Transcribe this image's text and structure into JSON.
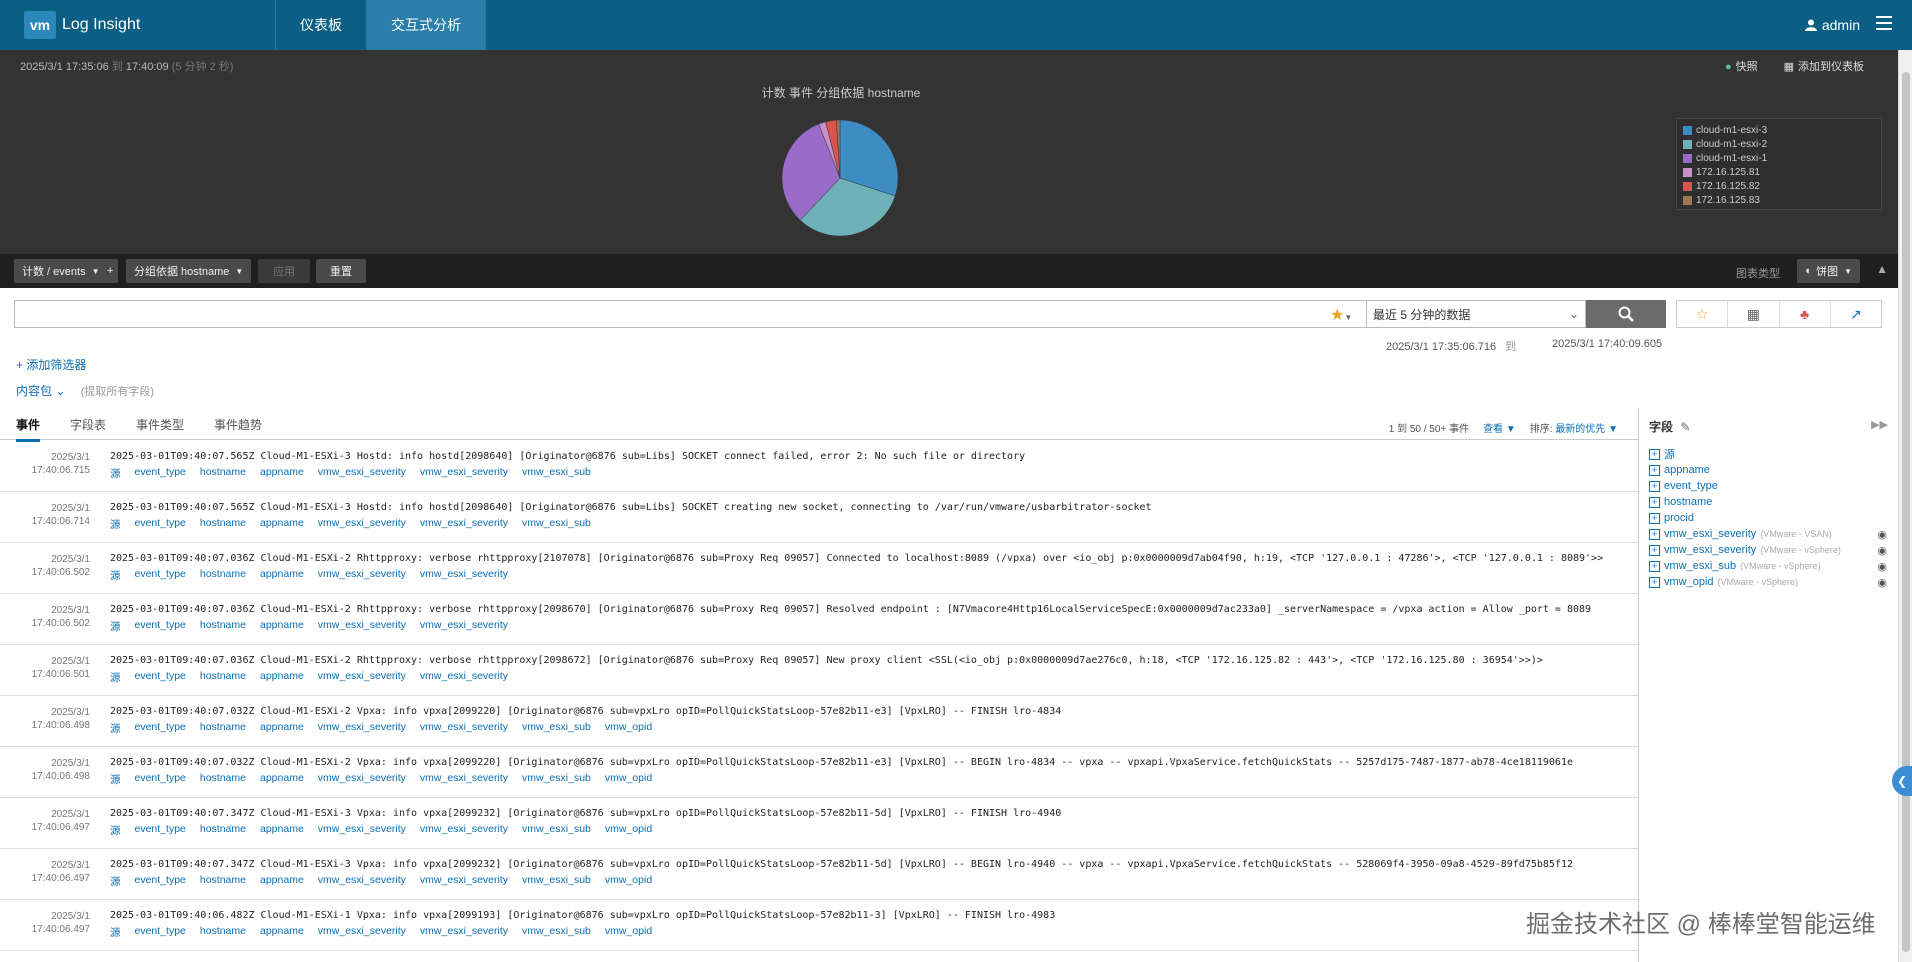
{
  "topbar": {
    "logo_badge": "vm",
    "app_name": "Log Insight",
    "tabs": [
      {
        "label": "仪表板",
        "active": false
      },
      {
        "label": "交互式分析",
        "active": true
      }
    ],
    "user": "admin"
  },
  "chart_panel": {
    "time_from": "2025/3/1  17:35:06",
    "time_to_sep": "到",
    "time_to": "17:40:09",
    "duration": "(5 分钟 2 秒)",
    "snapshot_label": "快照",
    "add_dashboard_label": "添加到仪表板"
  },
  "chart_data": {
    "type": "pie",
    "title": "计数 事件 分组依据 hostname",
    "categories": [
      "cloud-m1-esxi-3",
      "cloud-m1-esxi-2",
      "cloud-m1-esxi-1",
      "172.16.125.81",
      "172.16.125.82",
      "172.16.125.83"
    ],
    "values": [
      30,
      32,
      32,
      2,
      3,
      1
    ],
    "colors": [
      "#3d8cc4",
      "#6fb1b8",
      "#9a6bc8",
      "#c98fc9",
      "#d9534f",
      "#a07a4f"
    ],
    "legend": "right"
  },
  "toolbar": {
    "count_label": "计数 / events",
    "add_label": "+",
    "group_label": "分组依据 hostname",
    "apply_label": "应用",
    "reset_label": "重置",
    "chart_type_label": "图表类型",
    "chart_type_value": "饼图"
  },
  "search": {
    "query": "",
    "placeholder": "",
    "time_option": "最近 5 分钟的数据",
    "date_from": "2025/3/1 17:35:06.716",
    "date_sep": "到",
    "date_to": "2025/3/1 17:40:09.605"
  },
  "filters": {
    "add_filter": "+ 添加筛选器",
    "content_pack": "内容包",
    "extract_all": "(提取所有字段)"
  },
  "subtabs": [
    "事件",
    "字段表",
    "事件类型",
    "事件趋势"
  ],
  "pager": {
    "count_text": "1 到 50 / 50+ 事件",
    "view_label": "查看",
    "sort_label": "排序:",
    "sort_value": "最新的优先"
  },
  "events": [
    {
      "date": "2025/3/1",
      "time": "17:40:06.715",
      "msg": "2025-03-01T09:40:07.565Z Cloud-M1-ESXi-3 Hostd: info hostd[2098640] [Originator@6876 sub=Libs] SOCKET connect failed, error 2: No such file or directory",
      "tags": [
        "源",
        "event_type",
        "hostname",
        "appname",
        "vmw_esxi_severity",
        "vmw_esxi_severity",
        "vmw_esxi_sub"
      ]
    },
    {
      "date": "2025/3/1",
      "time": "17:40:06.714",
      "msg": "2025-03-01T09:40:07.565Z Cloud-M1-ESXi-3 Hostd: info hostd[2098640] [Originator@6876 sub=Libs] SOCKET creating new socket, connecting to /var/run/vmware/usbarbitrator-socket",
      "tags": [
        "源",
        "event_type",
        "hostname",
        "appname",
        "vmw_esxi_severity",
        "vmw_esxi_severity",
        "vmw_esxi_sub"
      ]
    },
    {
      "date": "2025/3/1",
      "time": "17:40:06.502",
      "msg": "2025-03-01T09:40:07.036Z Cloud-M1-ESXi-2 Rhttpproxy: verbose rhttpproxy[2107078] [Originator@6876 sub=Proxy Req 09057] Connected to localhost:8089 (/vpxa) over <io_obj p:0x0000009d7ab04f90, h:19, <TCP '127.0.0.1 : 47286'>, <TCP '127.0.0.1 : 8089'>>",
      "tags": [
        "源",
        "event_type",
        "hostname",
        "appname",
        "vmw_esxi_severity",
        "vmw_esxi_severity"
      ]
    },
    {
      "date": "2025/3/1",
      "time": "17:40:06.502",
      "msg": "2025-03-01T09:40:07.036Z Cloud-M1-ESXi-2 Rhttpproxy: verbose rhttpproxy[2098670] [Originator@6876 sub=Proxy Req 09057] Resolved endpoint : [N7Vmacore4Http16LocalServiceSpecE:0x0000009d7ac233a0] _serverNamespace = /vpxa action = Allow _port = 8089",
      "tags": [
        "源",
        "event_type",
        "hostname",
        "appname",
        "vmw_esxi_severity",
        "vmw_esxi_severity"
      ]
    },
    {
      "date": "2025/3/1",
      "time": "17:40:06.501",
      "msg": "2025-03-01T09:40:07.036Z Cloud-M1-ESXi-2 Rhttpproxy: verbose rhttpproxy[2098672] [Originator@6876 sub=Proxy Req 09057] New proxy client <SSL(<io_obj p:0x0000009d7ae276c0, h:18, <TCP '172.16.125.82 : 443'>, <TCP '172.16.125.80 : 36954'>>)>",
      "tags": [
        "源",
        "event_type",
        "hostname",
        "appname",
        "vmw_esxi_severity",
        "vmw_esxi_severity"
      ]
    },
    {
      "date": "2025/3/1",
      "time": "17:40:06.498",
      "msg": "2025-03-01T09:40:07.032Z Cloud-M1-ESXi-2 Vpxa: info vpxa[2099220] [Originator@6876 sub=vpxLro opID=PollQuickStatsLoop-57e82b11-e3] [VpxLRO] -- FINISH lro-4834",
      "tags": [
        "源",
        "event_type",
        "hostname",
        "appname",
        "vmw_esxi_severity",
        "vmw_esxi_severity",
        "vmw_esxi_sub",
        "vmw_opid"
      ]
    },
    {
      "date": "2025/3/1",
      "time": "17:40:06.498",
      "msg": "2025-03-01T09:40:07.032Z Cloud-M1-ESXi-2 Vpxa: info vpxa[2099220] [Originator@6876 sub=vpxLro opID=PollQuickStatsLoop-57e82b11-e3] [VpxLRO] -- BEGIN lro-4834 -- vpxa -- vpxapi.VpxaService.fetchQuickStats -- 5257d175-7487-1877-ab78-4ce18119061e",
      "tags": [
        "源",
        "event_type",
        "hostname",
        "appname",
        "vmw_esxi_severity",
        "vmw_esxi_severity",
        "vmw_esxi_sub",
        "vmw_opid"
      ]
    },
    {
      "date": "2025/3/1",
      "time": "17:40:06.497",
      "msg": "2025-03-01T09:40:07.347Z Cloud-M1-ESXi-3 Vpxa: info vpxa[2099232] [Originator@6876 sub=vpxLro opID=PollQuickStatsLoop-57e82b11-5d] [VpxLRO] -- FINISH lro-4940",
      "tags": [
        "源",
        "event_type",
        "hostname",
        "appname",
        "vmw_esxi_severity",
        "vmw_esxi_severity",
        "vmw_esxi_sub",
        "vmw_opid"
      ]
    },
    {
      "date": "2025/3/1",
      "time": "17:40:06.497",
      "msg": "2025-03-01T09:40:07.347Z Cloud-M1-ESXi-3 Vpxa: info vpxa[2099232] [Originator@6876 sub=vpxLro opID=PollQuickStatsLoop-57e82b11-5d] [VpxLRO] -- BEGIN lro-4940 -- vpxa -- vpxapi.VpxaService.fetchQuickStats -- 528069f4-3950-09a8-4529-89fd75b85f12",
      "tags": [
        "源",
        "event_type",
        "hostname",
        "appname",
        "vmw_esxi_severity",
        "vmw_esxi_severity",
        "vmw_esxi_sub",
        "vmw_opid"
      ]
    },
    {
      "date": "2025/3/1",
      "time": "17:40:06.497",
      "msg": "2025-03-01T09:40:06.482Z Cloud-M1-ESXi-1 Vpxa: info vpxa[2099193] [Originator@6876 sub=vpxLro opID=PollQuickStatsLoop-57e82b11-3] [VpxLRO] -- FINISH lro-4983",
      "tags": [
        "源",
        "event_type",
        "hostname",
        "appname",
        "vmw_esxi_severity",
        "vmw_esxi_severity",
        "vmw_esxi_sub",
        "vmw_opid"
      ]
    }
  ],
  "fields_panel": {
    "title": "字段",
    "fields": [
      {
        "name": "源",
        "source": "",
        "eye": false
      },
      {
        "name": "appname",
        "source": "",
        "eye": false
      },
      {
        "name": "event_type",
        "source": "",
        "eye": false
      },
      {
        "name": "hostname",
        "source": "",
        "eye": false
      },
      {
        "name": "procid",
        "source": "",
        "eye": false
      },
      {
        "name": "vmw_esxi_severity",
        "source": "(VMware - VSAN)",
        "eye": true
      },
      {
        "name": "vmw_esxi_severity",
        "source": "(VMware - vSphere)",
        "eye": true
      },
      {
        "name": "vmw_esxi_sub",
        "source": "(VMware - vSphere)",
        "eye": true
      },
      {
        "name": "vmw_opid",
        "source": "(VMware - vSphere)",
        "eye": true
      }
    ]
  },
  "watermark": "掘金技术社区 @ 棒棒堂智能运维"
}
